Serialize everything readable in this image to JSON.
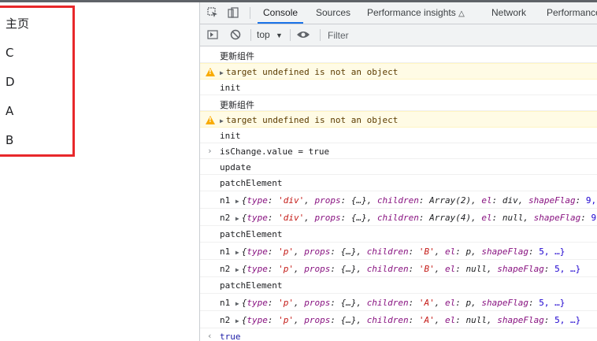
{
  "page": {
    "items": [
      "主页",
      "C",
      "D",
      "A",
      "B"
    ]
  },
  "devtools": {
    "tabs": [
      "Console",
      "Sources",
      "Performance insights",
      "Network",
      "Performance"
    ],
    "context": "top",
    "filter_placeholder": "Filter"
  },
  "console": {
    "lines": [
      {
        "type": "log",
        "text": "更新组件"
      },
      {
        "type": "warn",
        "text": "target undefined is not an object"
      },
      {
        "type": "log",
        "text": "init"
      },
      {
        "type": "log",
        "text": "更新组件"
      },
      {
        "type": "warn",
        "text": "target undefined is not an object"
      },
      {
        "type": "log",
        "text": "init"
      },
      {
        "type": "input",
        "text": "isChange.value = true"
      },
      {
        "type": "log",
        "text": "update"
      },
      {
        "type": "log",
        "text": "patchElement"
      },
      {
        "type": "obj",
        "label": "n1",
        "ptype": "'div'",
        "children": "Array(2)",
        "el": "div",
        "shapeFlag": "9,"
      },
      {
        "type": "obj",
        "label": "n2",
        "ptype": "'div'",
        "children": "Array(4)",
        "el": "null",
        "shapeFlag": "9"
      },
      {
        "type": "log",
        "text": "patchElement"
      },
      {
        "type": "obj",
        "label": "n1",
        "ptype": "'p'",
        "children": "'B'",
        "el": "p",
        "shapeFlag": "5, …}"
      },
      {
        "type": "obj",
        "label": "n2",
        "ptype": "'p'",
        "children": "'B'",
        "el": "null",
        "shapeFlag": "5, …}"
      },
      {
        "type": "log",
        "text": "patchElement"
      },
      {
        "type": "obj",
        "label": "n1",
        "ptype": "'p'",
        "children": "'A'",
        "el": "p",
        "shapeFlag": "5, …}"
      },
      {
        "type": "obj",
        "label": "n2",
        "ptype": "'p'",
        "children": "'A'",
        "el": "null",
        "shapeFlag": "5, …}"
      },
      {
        "type": "result",
        "text": "true"
      }
    ]
  }
}
